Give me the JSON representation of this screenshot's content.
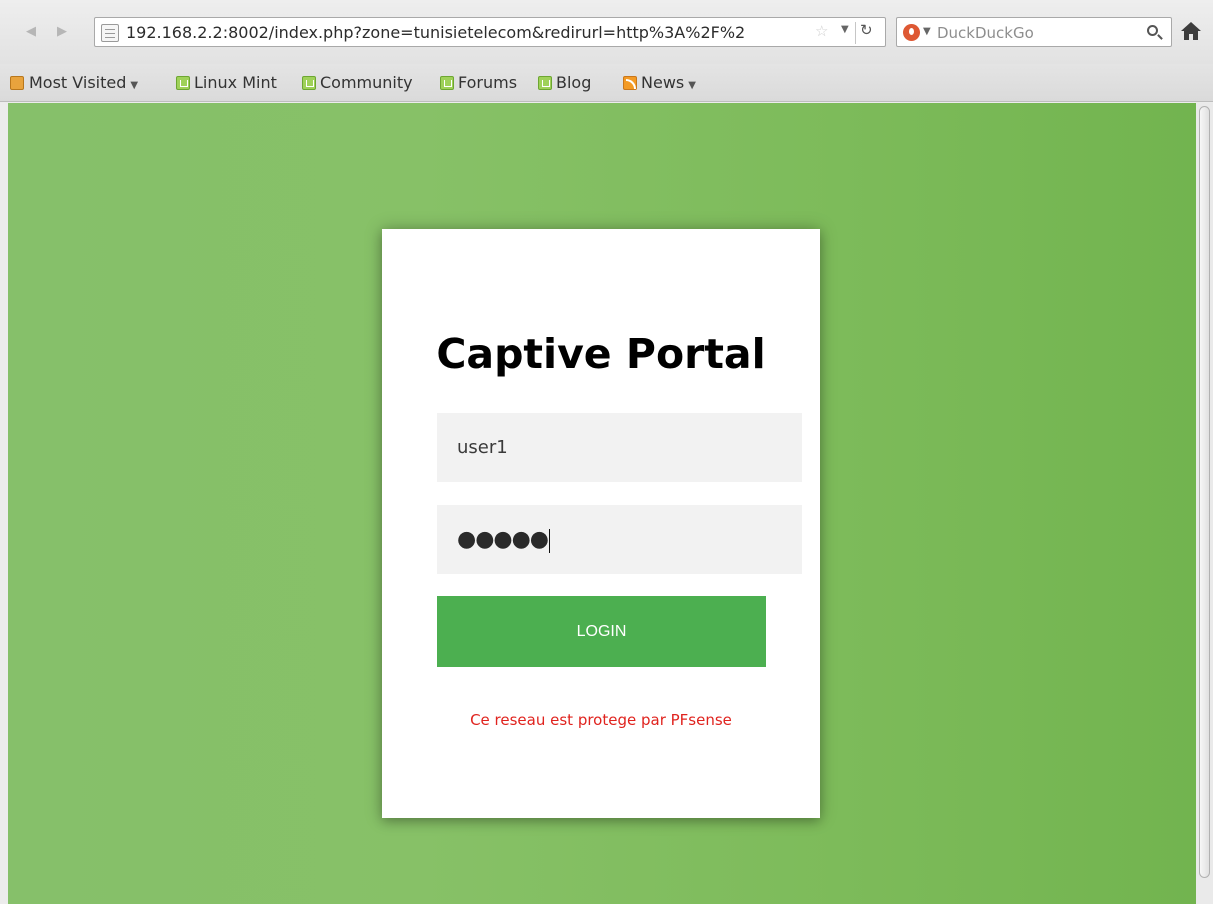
{
  "browser": {
    "url": "192.168.2.2:8002/index.php?zone=tunisietelecom&redirurl=http%3A%2F%2",
    "search_placeholder": "DuckDuckGo",
    "search_engine_icon": "duckduckgo-icon"
  },
  "bookmarks": [
    {
      "label": "Most Visited",
      "icon": "folder",
      "dropdown": true
    },
    {
      "label": "Linux Mint",
      "icon": "mint",
      "dropdown": false
    },
    {
      "label": "Community",
      "icon": "mint",
      "dropdown": false
    },
    {
      "label": "Forums",
      "icon": "mint",
      "dropdown": false
    },
    {
      "label": "Blog",
      "icon": "mint",
      "dropdown": false
    },
    {
      "label": "News",
      "icon": "rss",
      "dropdown": true
    }
  ],
  "portal": {
    "title": "Captive Portal",
    "username_value": "user1",
    "password_mask": "●●●●●",
    "login_label": "LOGIN",
    "footer_note": "Ce reseau est protege par PFsense"
  },
  "colors": {
    "background_green": "#7dbb5a",
    "button_green": "#4caf50",
    "note_red": "#e0231e"
  }
}
